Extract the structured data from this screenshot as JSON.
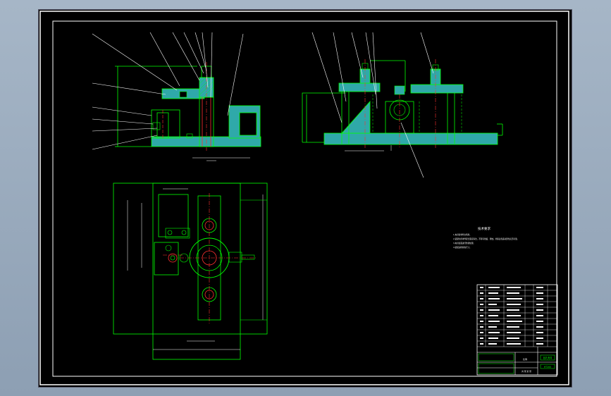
{
  "colors": {
    "background": "#000000",
    "frame": "#ffffff",
    "geometry": "#00ff00",
    "dimension": "#ffffff",
    "section_fill": "#2fa9a9",
    "centerline": "#ff3030",
    "leader": "#ffffff",
    "title_block": "#ffffff",
    "notes": "#ffffff",
    "window_bg": "#9fb0c3"
  },
  "notes": {
    "title": "技术要求",
    "lines": [
      "1.夹具各零件去毛刺。",
      "2.装配时各零件配合面应清洁，不得有划痕、锈蚀，并保证各运动部位灵活可靠。",
      "3.夹具表面进行防锈处理。",
      "4.装配后检验各尺寸。"
    ]
  },
  "title_block": {
    "drawing_name": "钻孔夹具",
    "material": "HT200",
    "scale_label": "比例",
    "sheet_label": "共 张 第 张"
  }
}
